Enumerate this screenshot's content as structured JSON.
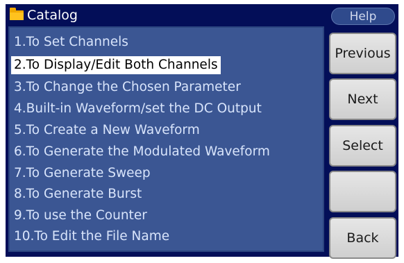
{
  "title_bar": {
    "icon": "folder-icon",
    "title": "Catalog"
  },
  "catalog": {
    "selected_index": 1,
    "items": [
      "1.To Set Channels",
      "2.To Display/Edit Both Channels",
      "3.To Change the Chosen Parameter",
      "4.Built-in Waveform/set the DC Output",
      "5.To Create a New Waveform",
      "6.To Generate the Modulated Waveform",
      "7.To Generate Sweep",
      "8.To Generate Burst",
      "9.To use the Counter",
      "10.To Edit the File Name"
    ]
  },
  "side_menu": {
    "help_label": "Help",
    "keys": [
      "Previous",
      "Next",
      "Select",
      "",
      "Back"
    ]
  },
  "colors": {
    "frame": "#030e58",
    "list_background": "#3b5693",
    "list_text": "#d8e4fb",
    "selected_background": "#ffffff",
    "selected_text": "#000000",
    "soft_key": "#d9d9d9",
    "folder": "#ffc21e"
  }
}
